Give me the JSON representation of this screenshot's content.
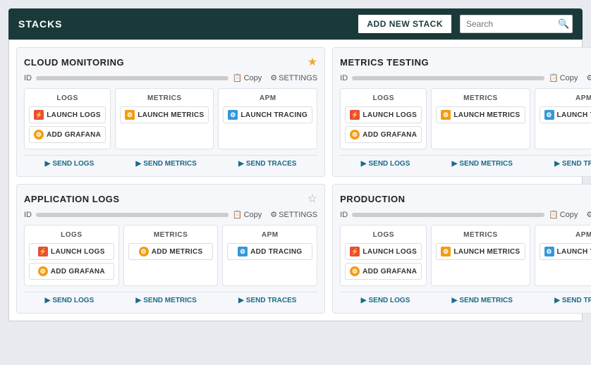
{
  "header": {
    "title": "STACKS",
    "add_button_label": "ADD NEW STACK",
    "search_placeholder": "Search"
  },
  "stacks": [
    {
      "id": "stack-cloud-monitoring",
      "title": "CLOUD MONITORING",
      "starred": true,
      "id_label": "ID",
      "copy_label": "Copy",
      "settings_label": "SETTINGS",
      "services": [
        {
          "label": "LOGS",
          "buttons": [
            {
              "id": "launch-logs-1",
              "text": "LAUNCH LOGS",
              "icon_type": "logs"
            },
            {
              "id": "add-grafana-1",
              "text": "ADD GRAFANA",
              "icon_type": "grafana"
            }
          ]
        },
        {
          "label": "METRICS",
          "buttons": [
            {
              "id": "launch-metrics-1",
              "text": "LAUNCH METRICS",
              "icon_type": "metrics"
            }
          ]
        },
        {
          "label": "APM",
          "buttons": [
            {
              "id": "launch-tracing-1",
              "text": "LAUNCH TRACING",
              "icon_type": "apm"
            }
          ]
        }
      ],
      "bottom_links": [
        {
          "id": "send-logs-1",
          "text": "SEND LOGS"
        },
        {
          "id": "send-metrics-1",
          "text": "SEND METRICS"
        },
        {
          "id": "send-traces-1",
          "text": "SEND TRACES"
        }
      ]
    },
    {
      "id": "stack-metrics-testing",
      "title": "METRICS TESTING",
      "starred": false,
      "id_label": "ID",
      "copy_label": "Copy",
      "settings_label": "SETTINGS",
      "services": [
        {
          "label": "LOGS",
          "buttons": [
            {
              "id": "launch-logs-2",
              "text": "LAUNCH LOGS",
              "icon_type": "logs"
            },
            {
              "id": "add-grafana-2",
              "text": "ADD GRAFANA",
              "icon_type": "grafana"
            }
          ]
        },
        {
          "label": "METRICS",
          "buttons": [
            {
              "id": "launch-metrics-2",
              "text": "LAUNCH METRICS",
              "icon_type": "metrics"
            }
          ]
        },
        {
          "label": "APM",
          "buttons": [
            {
              "id": "launch-tracing-2",
              "text": "LAUNCH TRACING",
              "icon_type": "apm"
            }
          ]
        }
      ],
      "bottom_links": [
        {
          "id": "send-logs-2",
          "text": "SEND LOGS"
        },
        {
          "id": "send-metrics-2",
          "text": "SEND METRICS"
        },
        {
          "id": "send-traces-2",
          "text": "SEND TRACES"
        }
      ]
    },
    {
      "id": "stack-application-logs",
      "title": "APPLICATION LOGS",
      "starred": false,
      "id_label": "ID",
      "copy_label": "Copy",
      "settings_label": "SETTINGS",
      "services": [
        {
          "label": "LOGS",
          "buttons": [
            {
              "id": "launch-logs-3",
              "text": "LAUNCH LOGS",
              "icon_type": "logs"
            },
            {
              "id": "add-grafana-3",
              "text": "ADD GRAFANA",
              "icon_type": "grafana"
            }
          ]
        },
        {
          "label": "METRICS",
          "buttons": [
            {
              "id": "add-metrics-3",
              "text": "ADD METRICS",
              "icon_type": "add-metrics"
            }
          ]
        },
        {
          "label": "APM",
          "buttons": [
            {
              "id": "add-tracing-3",
              "text": "ADD TRACING",
              "icon_type": "add-tracing"
            }
          ]
        }
      ],
      "bottom_links": [
        {
          "id": "send-logs-3",
          "text": "SEND LOGS"
        },
        {
          "id": "send-metrics-3",
          "text": "SEND METRICS"
        },
        {
          "id": "send-traces-3",
          "text": "SEND TRACES"
        }
      ]
    },
    {
      "id": "stack-production",
      "title": "PRODUCTION",
      "starred": false,
      "id_label": "ID",
      "copy_label": "Copy",
      "settings_label": "SETTINGS",
      "services": [
        {
          "label": "LOGS",
          "buttons": [
            {
              "id": "launch-logs-4",
              "text": "LAUNCH LOGS",
              "icon_type": "logs"
            },
            {
              "id": "add-grafana-4",
              "text": "ADD GRAFANA",
              "icon_type": "grafana"
            }
          ]
        },
        {
          "label": "METRICS",
          "buttons": [
            {
              "id": "launch-metrics-4",
              "text": "LAUNCH METRICS",
              "icon_type": "metrics"
            }
          ]
        },
        {
          "label": "APM",
          "buttons": [
            {
              "id": "launch-tracing-4",
              "text": "LAUNCH TRACING",
              "icon_type": "apm"
            }
          ]
        }
      ],
      "bottom_links": [
        {
          "id": "send-logs-4",
          "text": "SEND LOGS"
        },
        {
          "id": "send-metrics-4",
          "text": "SEND METRICS"
        },
        {
          "id": "send-traces-4",
          "text": "SEND TRACES"
        }
      ]
    }
  ]
}
